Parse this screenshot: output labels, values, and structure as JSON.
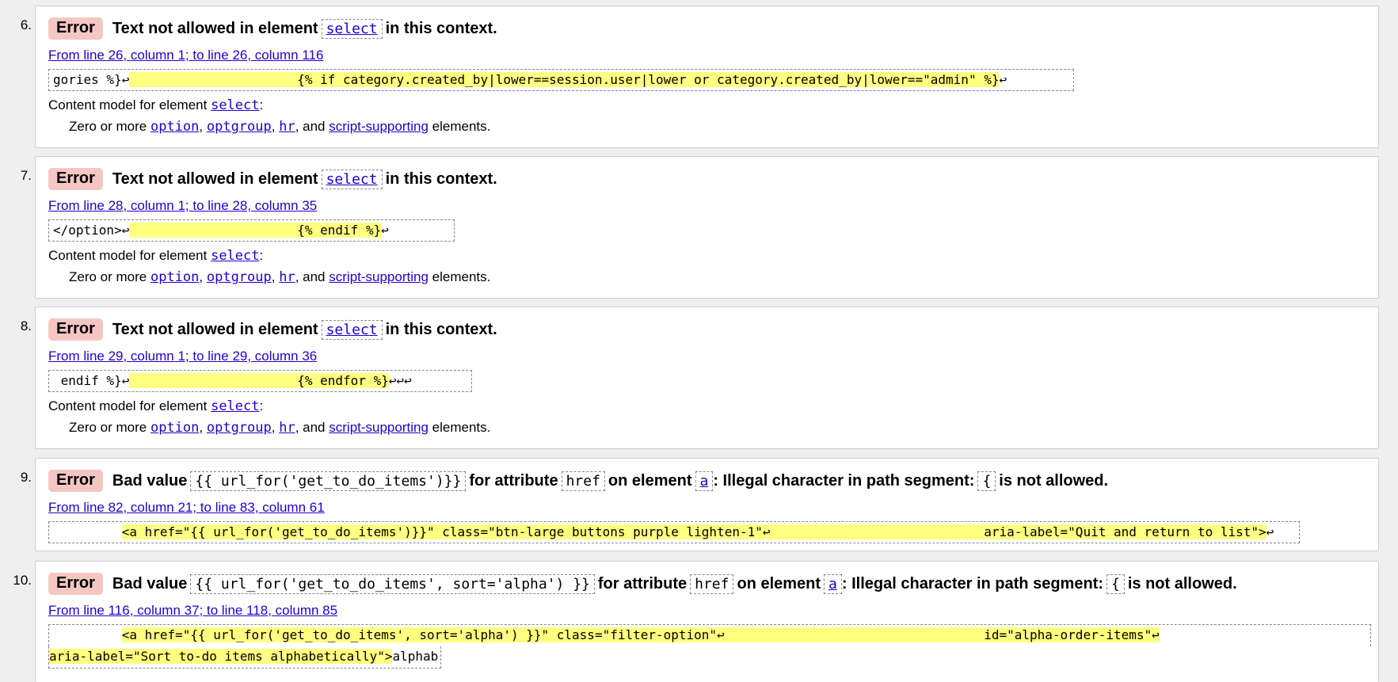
{
  "messages": [
    {
      "number": "6.",
      "badge": "Error",
      "message": "Text not allowed in element",
      "element": "select",
      "suffix": "in this context.",
      "location": "From line 26, column 1; to line 26, column 116",
      "code_pre": "gories %}↩",
      "code_hl": "                      {% if category.created_by|lower==session.user|lower or category.created_by|lower==\"admin\" %}",
      "code_post": "↩",
      "content_model_label": "Content model for element",
      "content_model_element": "select",
      "content_model_colon": ":",
      "zero_more": "Zero or more",
      "opt1": "option",
      "opt2": "optgroup",
      "opt3": "hr",
      "and": "and",
      "opt4": "script-supporting",
      "elements": "elements."
    },
    {
      "number": "7.",
      "badge": "Error",
      "message": "Text not allowed in element",
      "element": "select",
      "suffix": "in this context.",
      "location": "From line 28, column 1; to line 28, column 35",
      "code_pre": "</option>↩",
      "code_hl": "                      {% endif %}",
      "code_post": "↩",
      "content_model_label": "Content model for element",
      "content_model_element": "select",
      "content_model_colon": ":",
      "zero_more": "Zero or more",
      "opt1": "option",
      "opt2": "optgroup",
      "opt3": "hr",
      "and": "and",
      "opt4": "script-supporting",
      "elements": "elements."
    },
    {
      "number": "8.",
      "badge": "Error",
      "message": "Text not allowed in element",
      "element": "select",
      "suffix": "in this context.",
      "location": "From line 29, column 1; to line 29, column 36",
      "code_pre": " endif %}↩",
      "code_hl": "                      {% endfor %}",
      "code_post": "↩↩↩",
      "content_model_label": "Content model for element",
      "content_model_element": "select",
      "content_model_colon": ":",
      "zero_more": "Zero or more",
      "opt1": "option",
      "opt2": "optgroup",
      "opt3": "hr",
      "and": "and",
      "opt4": "script-supporting",
      "elements": "elements."
    },
    {
      "number": "9.",
      "badge": "Error",
      "bad_value": "Bad value",
      "value": "{{ url_for('get_to_do_items')}}",
      "for_attribute": "for attribute",
      "attribute": "href",
      "on_element": "on element",
      "element": "a",
      "illegal": ": Illegal character in path segment:",
      "char": "{",
      "not_allowed": "is not allowed.",
      "location": "From line 82, column 21; to line 83, column 61",
      "code_pre": "         ",
      "code_hl": "<a href=\"{{ url_for('get_to_do_items')}}\" class=\"btn-large buttons purple lighten-1\"↩                            aria-label=\"Quit and return to list\">",
      "code_post": "↩"
    },
    {
      "number": "10.",
      "badge": "Error",
      "bad_value": "Bad value",
      "value": "{{ url_for('get_to_do_items', sort='alpha') }}",
      "for_attribute": "for attribute",
      "attribute": "href",
      "on_element": "on element",
      "element": "a",
      "illegal": ": Illegal character in path segment:",
      "char": "{",
      "not_allowed": "is not allowed.",
      "location": "From line 116, column 37; to line 118, column 85",
      "code_pre": "         ",
      "code_hl": "<a href=\"{{ url_for('get_to_do_items', sort='alpha') }}\" class=\"filter-option\"↩                                  id=\"alpha-order-items\"↩",
      "code_hl2": "aria-label=\"Sort to-do items alphabetically\">",
      "code_post2": "alphab"
    }
  ]
}
